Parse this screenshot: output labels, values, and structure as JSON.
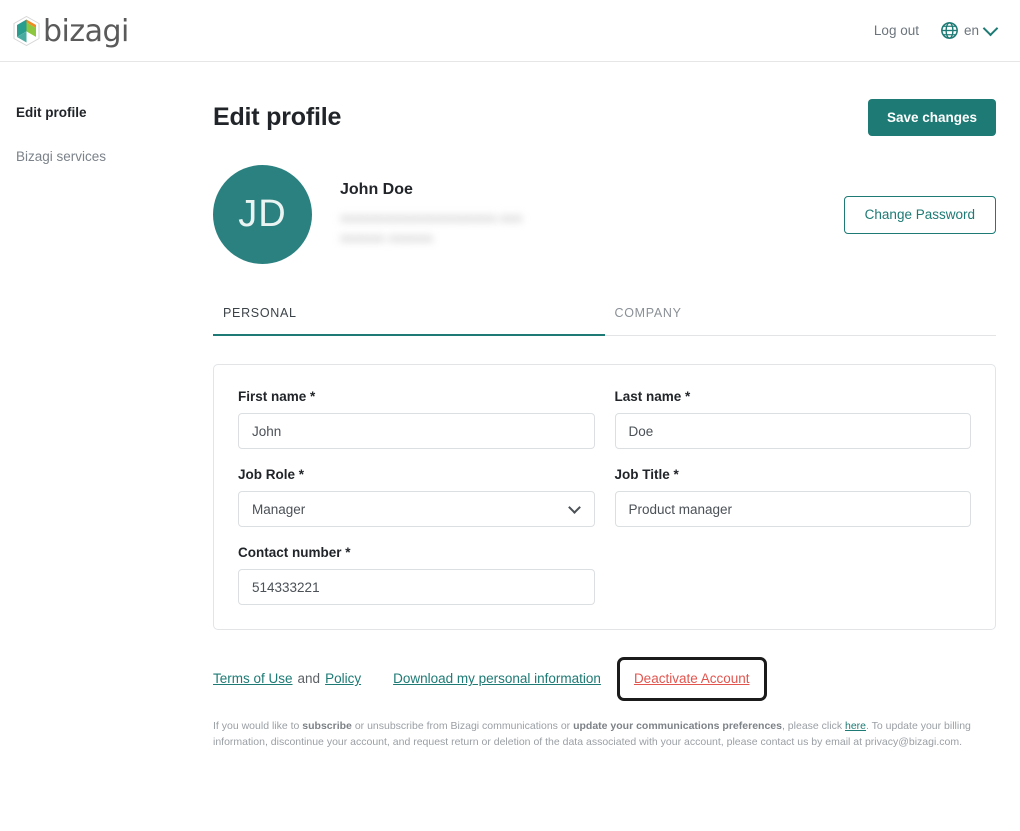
{
  "topbar": {
    "brand_word": "bizagi",
    "logout_label": "Log out",
    "language_code": "en",
    "globe_icon": "globe-icon",
    "chevron_icon": "chevron-down-icon"
  },
  "sidebar": {
    "items": [
      {
        "label": "Edit profile",
        "active": true
      },
      {
        "label": "Bizagi services",
        "active": false
      }
    ]
  },
  "header": {
    "title": "Edit profile",
    "save_label": "Save changes"
  },
  "profile": {
    "initials": "JD",
    "name": "John Doe",
    "email_redacted": "aaaaaaaaaaaaaaaaaaaaa.aaa",
    "detail_redacted": "aaaaaa  aaaaaa",
    "change_password_label": "Change Password"
  },
  "tabs": [
    {
      "label": "PERSONAL",
      "active": true
    },
    {
      "label": "COMPANY",
      "active": false
    }
  ],
  "form": {
    "first_name": {
      "label": "First name *",
      "value": "John"
    },
    "last_name": {
      "label": "Last name *",
      "value": "Doe"
    },
    "job_role": {
      "label": "Job Role *",
      "value": "Manager"
    },
    "job_title": {
      "label": "Job Title *",
      "value": "Product manager"
    },
    "contact_number": {
      "label": "Contact number *",
      "value": "514333221"
    }
  },
  "footer": {
    "terms_label": "Terms of Use",
    "and_label": "and",
    "policy_label": "Policy",
    "download_label": "Download my personal information",
    "deactivate_label": "Deactivate Account",
    "fineprint_1": "If you would like to ",
    "fineprint_bold_1": "subscribe",
    "fineprint_2": " or unsubscribe from Bizagi communications or ",
    "fineprint_bold_2": "update your communications preferences",
    "fineprint_3": ", please click ",
    "fineprint_here": "here",
    "fineprint_4": ". To update your billing information, discontinue your account, and request return or deletion of the data associated with your account, please contact us by email at privacy@bizagi.com."
  },
  "colors": {
    "brand_teal": "#1d7a74",
    "avatar_teal": "#2a8180",
    "danger_red": "#e2554f",
    "highlight_border": "#1b1b1b"
  }
}
